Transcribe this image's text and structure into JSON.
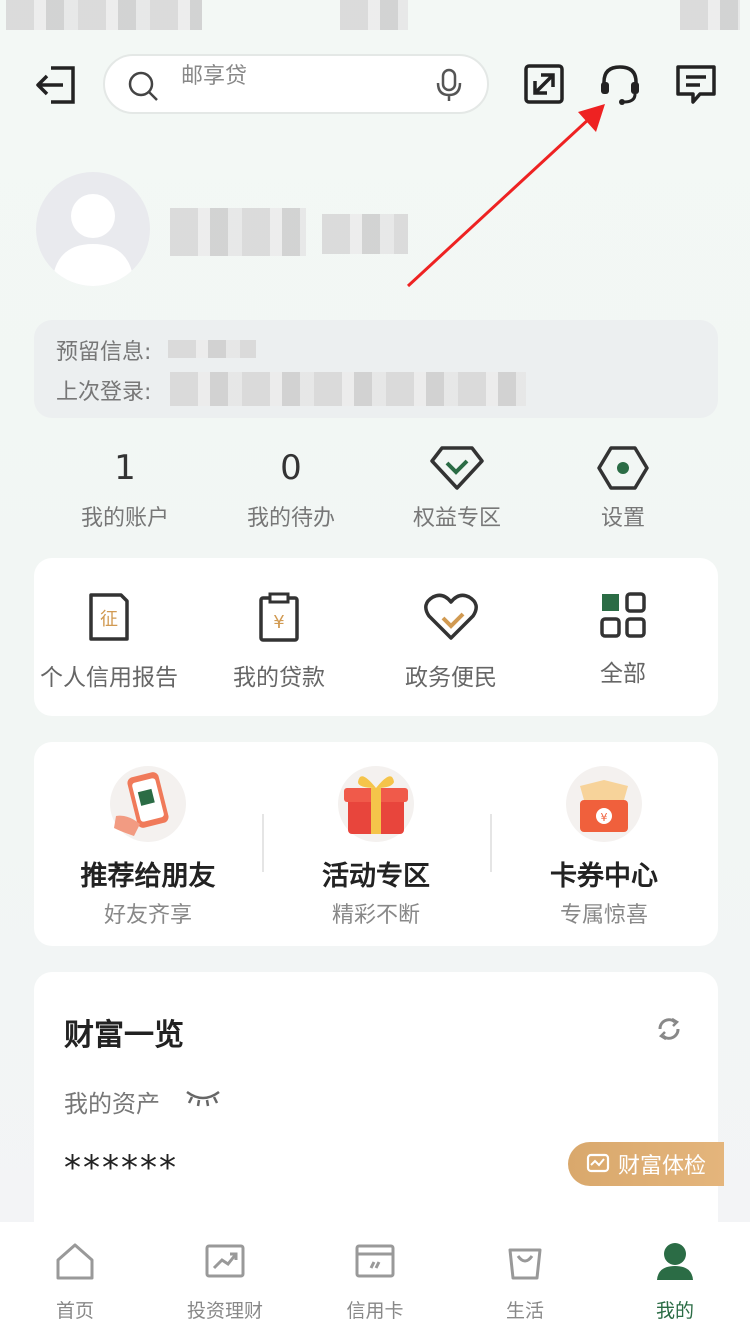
{
  "topbar": {
    "search_placeholder": "邮享贷"
  },
  "profile": {
    "reserved_info_label": "预留信息:",
    "last_login_label": "上次登录:"
  },
  "stats": [
    {
      "value": "1",
      "label": "我的账户"
    },
    {
      "value": "0",
      "label": "我的待办"
    },
    {
      "value": "",
      "label": "权益专区"
    },
    {
      "value": "",
      "label": "设置"
    }
  ],
  "services": [
    {
      "label": "个人信用报告",
      "icon": "credit-report-icon"
    },
    {
      "label": "我的贷款",
      "icon": "loan-icon"
    },
    {
      "label": "政务便民",
      "icon": "gov-service-icon"
    },
    {
      "label": "全部",
      "icon": "grid-icon"
    }
  ],
  "promos": [
    {
      "title": "推荐给朋友",
      "subtitle": "好友齐享"
    },
    {
      "title": "活动专区",
      "subtitle": "精彩不断"
    },
    {
      "title": "卡券中心",
      "subtitle": "专属惊喜"
    }
  ],
  "wealth": {
    "title": "财富一览",
    "assets_label": "我的资产",
    "assets_value": "******",
    "checkup_label": "财富体检"
  },
  "tabs": [
    {
      "label": "首页"
    },
    {
      "label": "投资理财"
    },
    {
      "label": "信用卡"
    },
    {
      "label": "生活"
    },
    {
      "label": "我的"
    }
  ],
  "colors": {
    "brand_green": "#2b6c45",
    "accent_gold": "#d9a86c",
    "annotation_red": "#ee2222"
  }
}
